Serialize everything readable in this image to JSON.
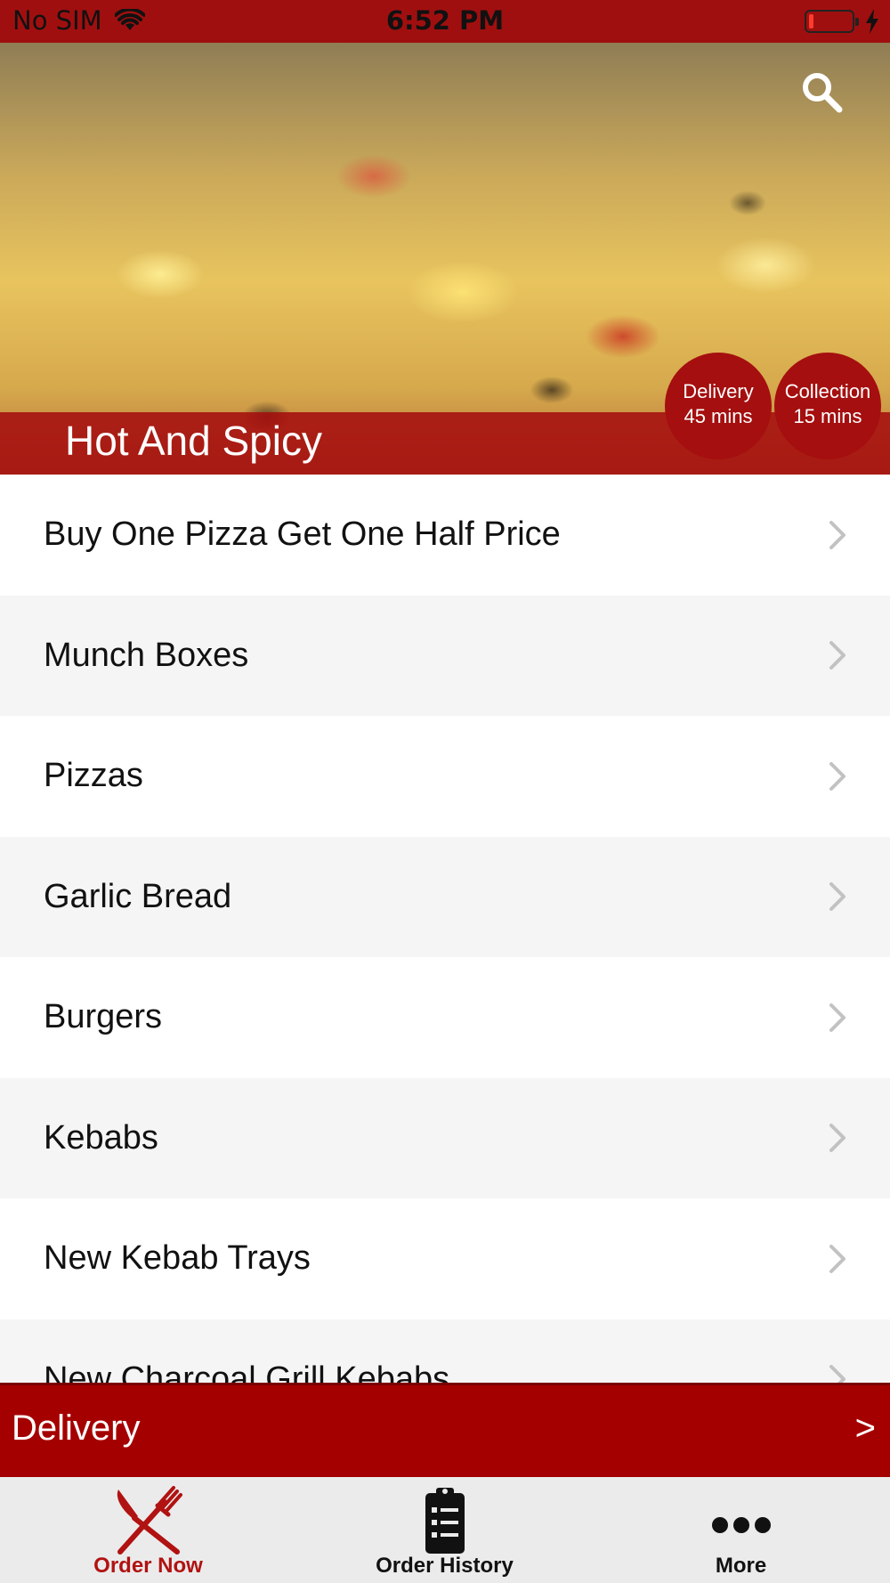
{
  "status_bar": {
    "carrier": "No SIM",
    "time": "6:52 PM",
    "battery_level": 0.1
  },
  "hero": {
    "title": "Hot And Spicy",
    "badges": [
      {
        "label": "Delivery",
        "time": "45 mins"
      },
      {
        "label": "Collection",
        "time": "15 mins"
      }
    ]
  },
  "menu": {
    "items": [
      {
        "label": "Buy One Pizza Get One Half Price"
      },
      {
        "label": "Munch Boxes"
      },
      {
        "label": "Pizzas"
      },
      {
        "label": "Garlic Bread"
      },
      {
        "label": "Burgers"
      },
      {
        "label": "Kebabs"
      },
      {
        "label": "New Kebab Trays"
      },
      {
        "label": "New Charcoal Grill Kebabs"
      }
    ]
  },
  "delivery_bar": {
    "label": "Delivery",
    "arrow": ">"
  },
  "tab_bar": {
    "tabs": [
      {
        "label": "Order Now",
        "icon": "fork-knife-icon",
        "active": true
      },
      {
        "label": "Order History",
        "icon": "clipboard-icon",
        "active": false
      },
      {
        "label": "More",
        "icon": "more-dots-icon",
        "active": false
      }
    ]
  },
  "colors": {
    "brand_red": "#a50f0f",
    "active_tab": "#b11212"
  }
}
